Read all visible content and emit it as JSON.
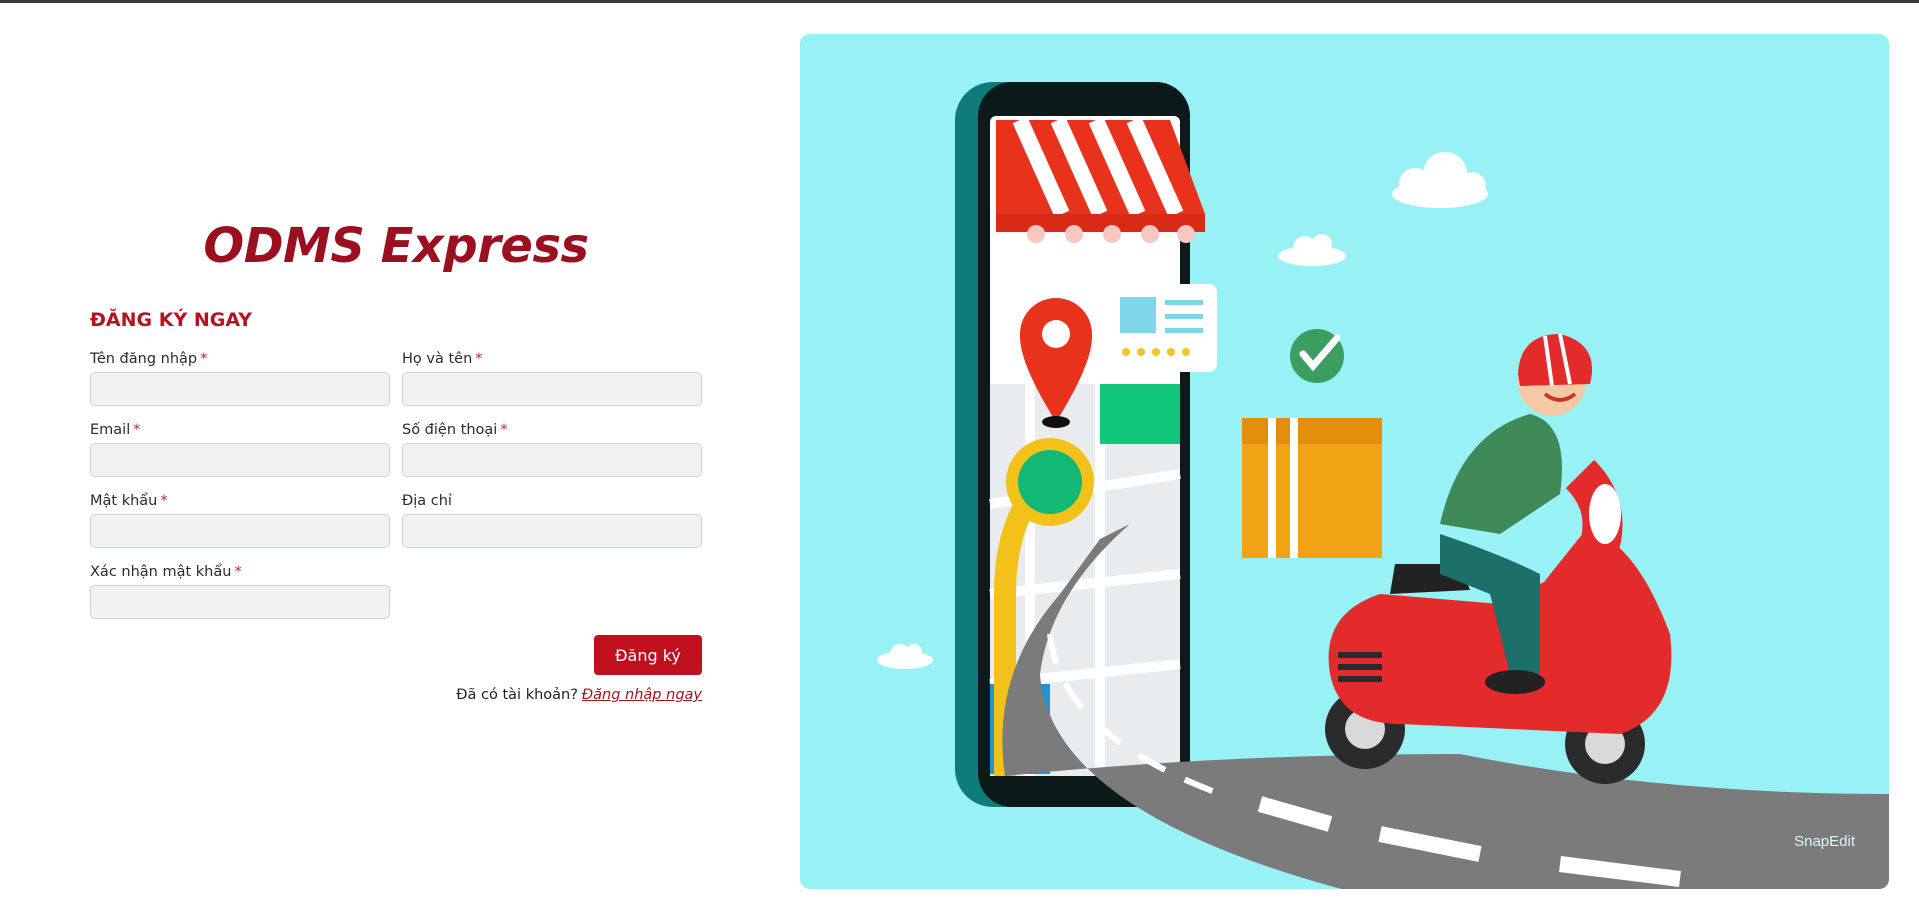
{
  "brand": {
    "title": "ODMS Express"
  },
  "form": {
    "heading": "ĐĂNG KÝ NGAY",
    "required_mark": "*",
    "fields": {
      "username": {
        "label": "Tên đăng nhập",
        "value": "",
        "required": true
      },
      "fullname": {
        "label": "Họ và tên",
        "value": "",
        "required": true
      },
      "email": {
        "label": "Email",
        "value": "",
        "required": true
      },
      "phone": {
        "label": "Số điện thoại",
        "value": "",
        "required": true
      },
      "password": {
        "label": "Mật khẩu",
        "value": "",
        "required": true
      },
      "address": {
        "label": "Địa chỉ",
        "value": "",
        "required": false
      },
      "confirm_password": {
        "label": "Xác nhận mật khẩu",
        "value": "",
        "required": true
      }
    },
    "submit_label": "Đăng ký",
    "login_prompt": "Đã có tài khoản?",
    "login_link": "Đăng nhập ngay"
  },
  "hero": {
    "description_icons": [
      "smartphone-icon",
      "shop-awning-icon",
      "map-pin-icon",
      "checkmark-badge-icon",
      "delivery-scooter-icon",
      "package-box-icon",
      "cloud-icon"
    ],
    "watermark": "SnapEdit"
  },
  "colors": {
    "brand": "#9b1020",
    "accent": "#c0101d",
    "hero_bg": "#97f1f5"
  }
}
